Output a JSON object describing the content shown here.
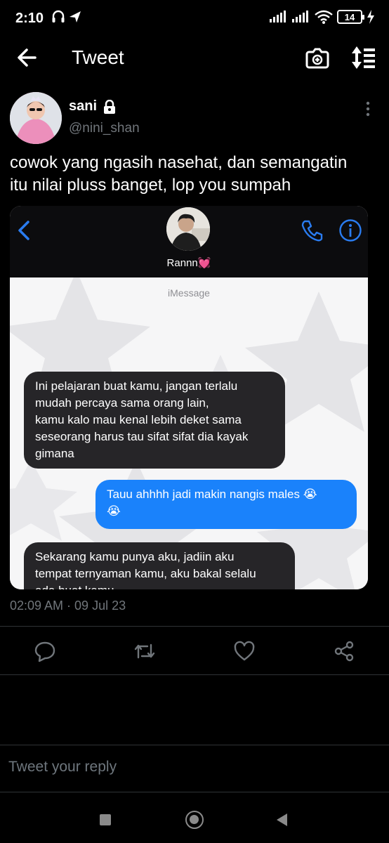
{
  "status_bar": {
    "time": "2:10",
    "battery": "14",
    "icons": [
      "headset-icon",
      "navigation-arrow-icon",
      "signal-icon",
      "signal-icon",
      "wifi-icon",
      "battery-icon",
      "charging-icon"
    ]
  },
  "app_bar": {
    "title": "Tweet",
    "icons": [
      "back-arrow-icon",
      "camera-add-icon",
      "sort-icon"
    ]
  },
  "tweet": {
    "display_name": "sani",
    "handle": "@nini_shan",
    "text": "cowok yang ngasih nasehat, dan semangatin\nitu nilai pluss banget, lop you sumpah",
    "timestamp": "02:09 AM · 09 Jul 23"
  },
  "screenshot_card": {
    "contact_name": "Rannn💓",
    "service": "iMessage",
    "messages": [
      {
        "direction": "incoming",
        "text": "Ini pelajaran buat kamu, jangan terlalu\nmudah percaya sama orang lain,\nkamu kalo mau kenal lebih deket sama\nseseorang harus tau sifat sifat dia kayak\ngimana"
      },
      {
        "direction": "outgoing",
        "text": "Tauu ahhhh jadi makin nangis males 😭\n😭"
      },
      {
        "direction": "incoming",
        "text": "Sekarang kamu punya aku, jadiin aku\ntempat ternyaman kamu, aku bakal selalu\nada buat kamu"
      },
      {
        "direction": "incoming",
        "text": "😉🫶🫶🫶"
      }
    ]
  },
  "actions": [
    "reply-icon",
    "retweet-icon",
    "like-icon",
    "share-icon"
  ],
  "reply_placeholder": "Tweet your reply",
  "colors": {
    "background": "#000000",
    "text_secondary": "#71767b",
    "imessage_blue": "#1a82fb",
    "incoming_bubble": "#262528",
    "ios_link_blue": "#2a7cf0"
  }
}
